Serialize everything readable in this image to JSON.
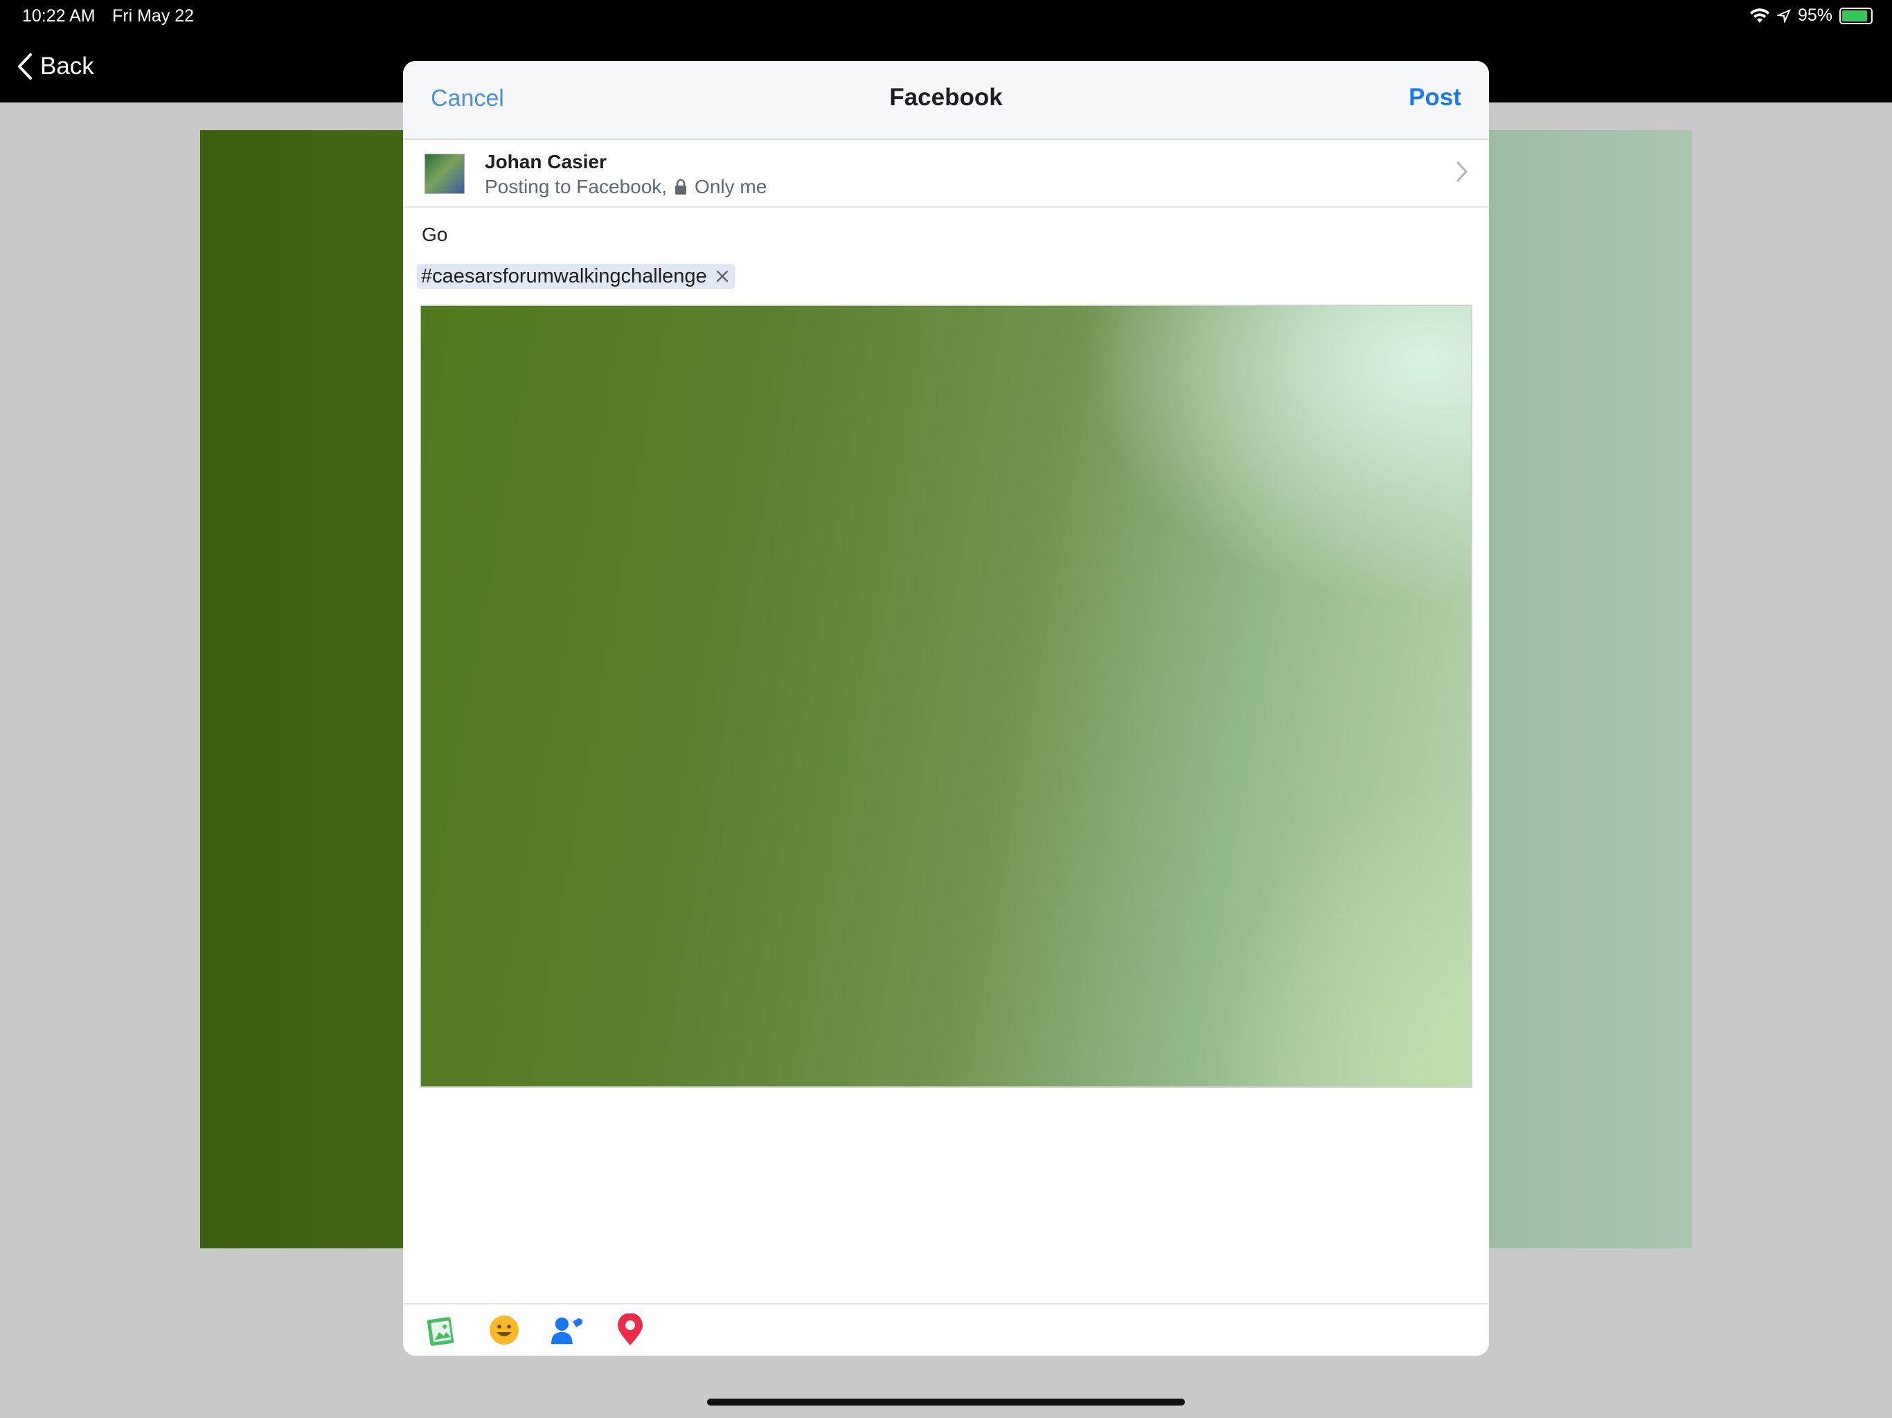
{
  "status_bar": {
    "time": "10:22 AM",
    "date": "Fri May 22",
    "battery": "95%"
  },
  "nav": {
    "back_label": "Back"
  },
  "composer": {
    "title": "Facebook",
    "cancel_label": "Cancel",
    "post_label": "Post",
    "account": {
      "name": "Johan Casier",
      "posting_to": "Posting to Facebook,",
      "audience": "Only me"
    },
    "text": "Go",
    "hashtag": "#caesarsforumwalkingchallenge",
    "toolbar": {
      "items": [
        {
          "icon": "photo-icon"
        },
        {
          "icon": "feeling-emoji-icon"
        },
        {
          "icon": "tag-people-icon"
        },
        {
          "icon": "location-pin-icon"
        }
      ]
    }
  },
  "colors": {
    "accent": "#1877f2",
    "cancel": "#4a90e2",
    "header_bg": "#f6f7f9",
    "hashtag_bg": "#e1e8f4",
    "location_pin": "#f02849",
    "emoji": "#f7b928",
    "photo_icon": "#45bd62"
  }
}
